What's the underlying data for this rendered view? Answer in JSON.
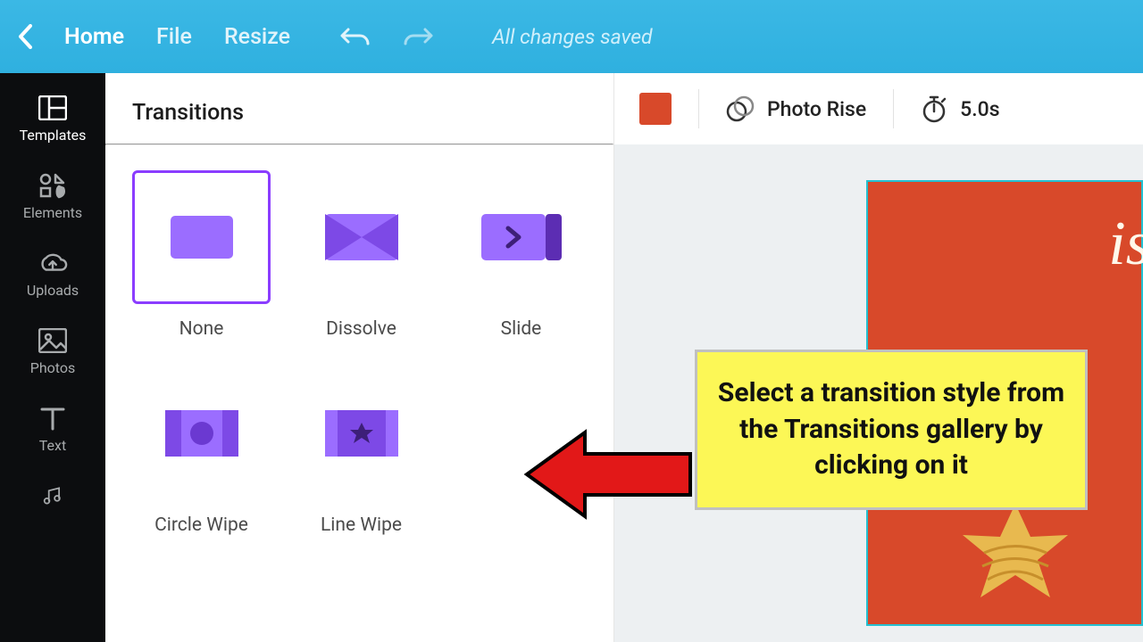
{
  "header": {
    "home": "Home",
    "file": "File",
    "resize": "Resize",
    "status": "All changes saved"
  },
  "rail": {
    "items": [
      {
        "label": "Templates",
        "icon": "templates-icon"
      },
      {
        "label": "Elements",
        "icon": "elements-icon"
      },
      {
        "label": "Uploads",
        "icon": "uploads-icon"
      },
      {
        "label": "Photos",
        "icon": "photos-icon"
      },
      {
        "label": "Text",
        "icon": "text-icon"
      }
    ]
  },
  "panel": {
    "title": "Transitions",
    "transitions": [
      {
        "label": "None",
        "selected": true
      },
      {
        "label": "Dissolve",
        "selected": false
      },
      {
        "label": "Slide",
        "selected": false
      },
      {
        "label": "Circle Wipe",
        "selected": false
      },
      {
        "label": "Line Wipe",
        "selected": false
      }
    ]
  },
  "toolbar": {
    "swatch": "#d8492a",
    "animation": "Photo Rise",
    "duration": "5.0s"
  },
  "annotation": {
    "text": "Select a transition style from the Transitions gallery by clicking on it"
  }
}
